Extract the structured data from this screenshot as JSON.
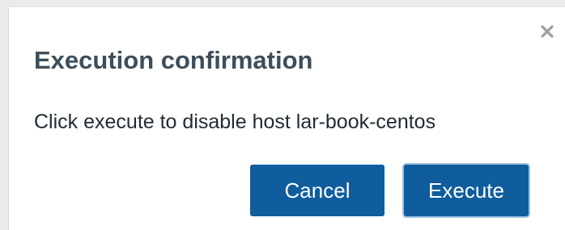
{
  "dialog": {
    "title": "Execution confirmation",
    "message": "Click execute to disable host lar-book-centos",
    "close_icon": "close-icon",
    "buttons": {
      "cancel_label": "Cancel",
      "execute_label": "Execute"
    }
  },
  "colors": {
    "button_background": "#0f5d9d",
    "button_text": "#ffffff",
    "title_text": "#3d4e5a",
    "focus_ring": "#9fc3e3"
  }
}
